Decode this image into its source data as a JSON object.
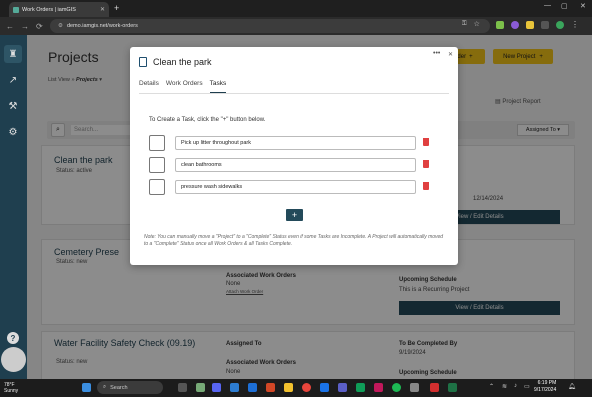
{
  "browser": {
    "tab_title": "Work Orders | iamGIS",
    "url": "demo.iamgis.net/work-orders"
  },
  "page": {
    "title": "Projects",
    "list_view_label": "List View",
    "list_view_sep": "»",
    "list_view_value": "Projects",
    "order_button": "der",
    "new_project_button": "New Project",
    "project_report": "Project Report",
    "search_placeholder": "Search...",
    "assigned_to_filter": "Assigned To",
    "cards": [
      {
        "title": "Clean the park",
        "status": "Status: active",
        "date": "12/14/2024",
        "action": "View / Edit Details"
      },
      {
        "title": "Cemetery Prese",
        "status": "Status: new",
        "associated_label": "Associated Work Orders",
        "associated_value": "None",
        "attach_link": "Attach Work Order",
        "schedule_label": "Upcoming Schedule",
        "schedule_value": "This is a Recurring Project",
        "action": "View / Edit Details"
      },
      {
        "title": "Water Facility Safety Check (09.19)",
        "status": "Status: new",
        "assigned_label": "Assigned To",
        "completed_label": "To Be Completed By",
        "completed_value": "9/19/2024",
        "associated_label": "Associated Work Orders",
        "associated_value": "None",
        "schedule_label": "Upcoming Schedule"
      }
    ]
  },
  "modal": {
    "title": "Clean the park",
    "tabs": [
      "Details",
      "Work Orders",
      "Tasks"
    ],
    "active_tab": "Tasks",
    "instruction": "To Create a Task, click the \"+\" button below.",
    "tasks": [
      "Pick up litter throughout park",
      "clean bathrooms",
      "pressure wash sidewalks"
    ],
    "add_label": "+",
    "note": "Note: You can manually move a \"Project\" to a \"Complete\" Status even if some Tasks are Incomplete. A Project will automatically moved to a \"Complete\" Status once all Work Orders & all Tasks Complete."
  },
  "taskbar": {
    "weather_temp": "78°F",
    "weather_desc": "Sunny",
    "search": "Search",
    "time": "6:19 PM",
    "date": "9/17/2024"
  }
}
